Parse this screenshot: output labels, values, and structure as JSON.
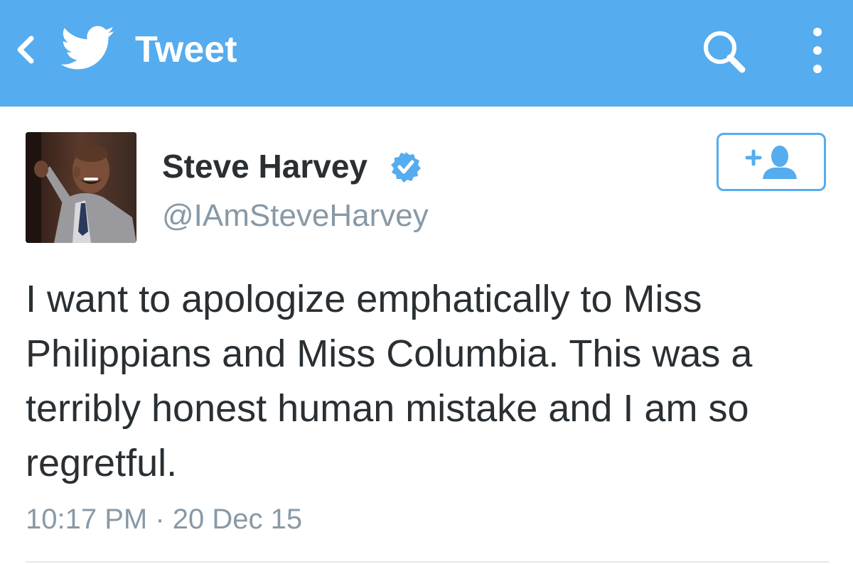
{
  "colors": {
    "brand": "#55acee",
    "text_primary": "#292f33",
    "text_secondary": "#8899a6",
    "background": "#ffffff"
  },
  "header": {
    "title": "Tweet",
    "icons": [
      "back-icon",
      "twitter-bird-icon",
      "search-icon",
      "more-vertical-icon"
    ]
  },
  "tweet": {
    "author": {
      "name": "Steve Harvey",
      "handle": "@IAmSteveHarvey",
      "verified": true,
      "avatar_icon": "avatar-photo"
    },
    "follow_button_icon": "follow-user-plus-icon",
    "text": "I want to apologize emphatically to Miss Philippians and Miss Columbia. This was a terribly honest human mistake and I am so regretful.",
    "timestamp": "10:17 PM · 20 Dec 15"
  }
}
